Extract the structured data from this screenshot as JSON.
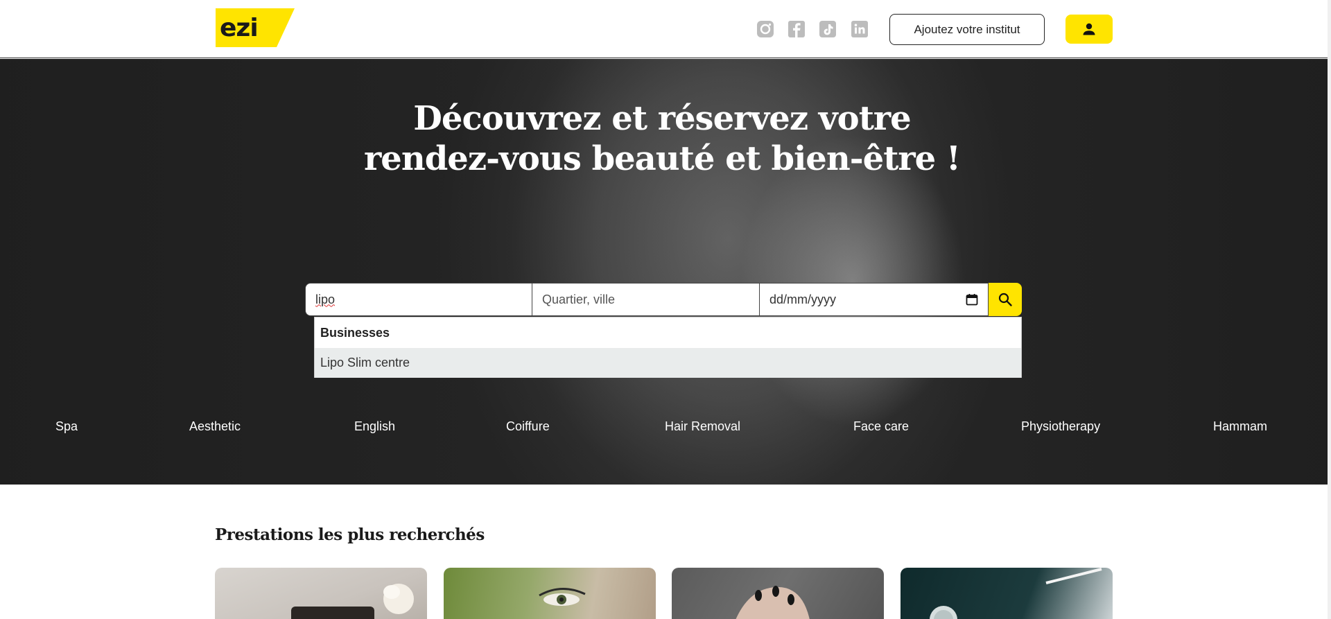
{
  "header": {
    "logo_text": "ezi",
    "add_button_label": "Ajoutez votre institut",
    "social_icons": [
      "instagram-icon",
      "facebook-icon",
      "tiktok-icon",
      "linkedin-icon"
    ],
    "account_icon": "user-icon"
  },
  "hero": {
    "title_line1": "Découvrez et réservez votre",
    "title_line2": "rendez-vous beauté et bien-être !"
  },
  "search": {
    "query_value": "lipo",
    "location_placeholder": "Quartier, ville",
    "date_placeholder": "dd/mm/yyyy",
    "search_icon": "search-icon",
    "calendar_icon": "calendar-icon"
  },
  "dropdown": {
    "group_label": "Businesses",
    "items": [
      "Lipo Slim centre"
    ]
  },
  "categories": [
    "Spa",
    "Aesthetic",
    "English",
    "Coiffure",
    "Hair Removal",
    "Face care",
    "Physiotherapy",
    "Hammam"
  ],
  "section": {
    "title": "Prestations les plus recherchés"
  },
  "colors": {
    "accent": "#ffe400",
    "hero_dark": "#262626",
    "dropdown_highlight": "#e9ecec"
  }
}
